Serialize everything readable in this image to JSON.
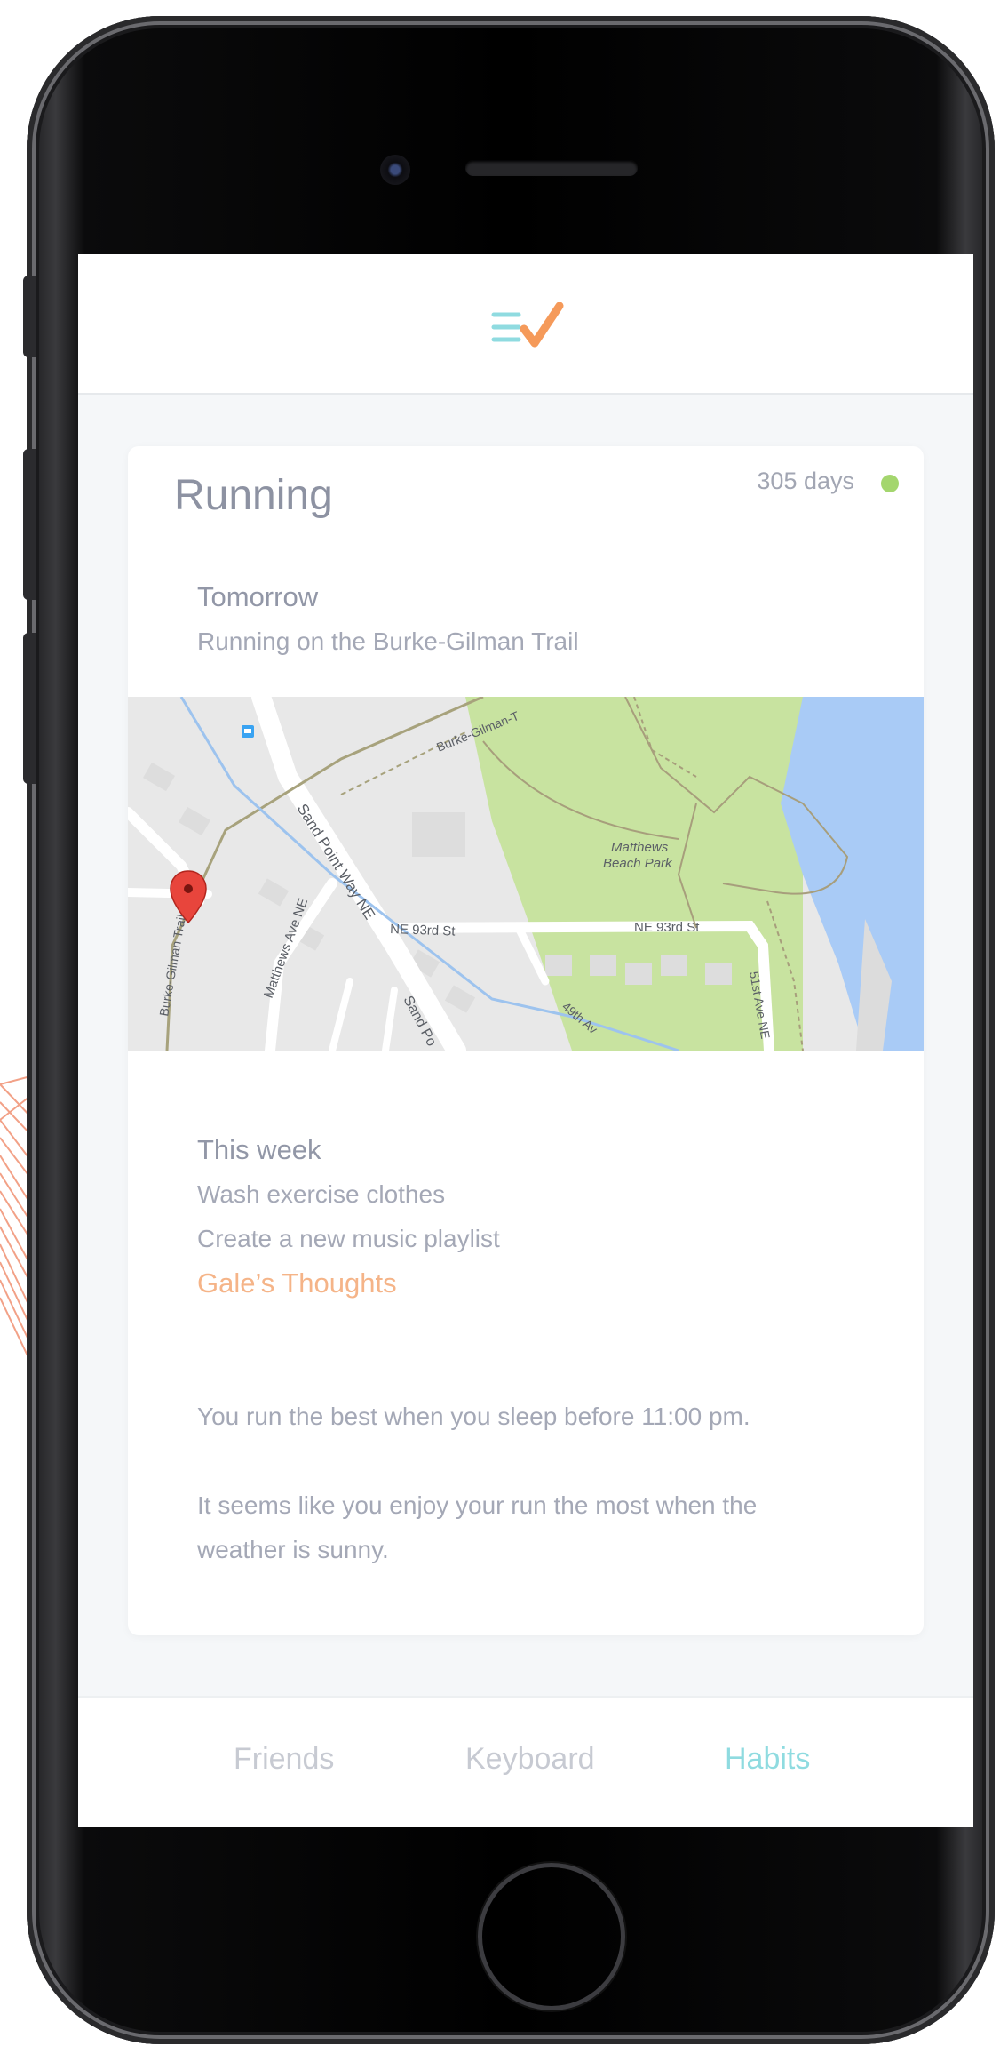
{
  "header": {
    "logo_icon": "menu-check-logo-icon"
  },
  "card": {
    "title": "Running",
    "streak": "305 days",
    "streak_color": "#a4d66e",
    "tomorrow_label": "Tomorrow",
    "tomorrow_item": "Running on the Burke-Gilman Trail",
    "map": {
      "labels": {
        "trail_top": "Burke-Gilman-T",
        "sand_point": "Sand Point Way NE",
        "park": [
          "Matthews",
          "Beach Park"
        ],
        "ne93_left": "NE 93rd St",
        "ne93_right": "NE 93rd St",
        "matthews_ave": "Matthews Ave NE",
        "trail_left": "Burke-Gilman Trail",
        "ave51": "51st Ave NE",
        "ave49": "49th Av",
        "sand_bottom": "Sand Po"
      },
      "pin_icon": "map-pin-icon"
    },
    "week_label": "This week",
    "week_items": [
      "Wash exercise clothes",
      "Create a new music playlist"
    ],
    "thoughts_label": "Gale’s Thoughts",
    "thoughts": [
      "You run the best when you sleep before 11:00 pm.",
      "It seems like you enjoy your run the most when the",
      "weather is sunny."
    ]
  },
  "tabs": {
    "friends": "Friends",
    "keyboard": "Keyboard",
    "habits": "Habits"
  },
  "colors": {
    "accent_teal": "#8fdbe0",
    "accent_orange": "#f59a5a",
    "tab_inactive": "#c7cad2",
    "title": "#8d92a2"
  }
}
